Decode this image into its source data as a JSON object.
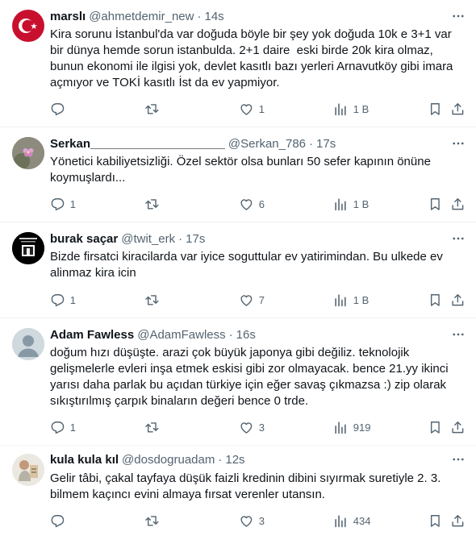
{
  "tweets": [
    {
      "name": "marslı",
      "handle": "@ahmetdemir_new",
      "time": "14s",
      "text": "Kira sorunu İstanbul'da var doğuda böyle bir şey yok doğuda 10k e 3+1 var\nbir dünya hemde sorun istanbulda. 2+1 daire  eski birde 20k kira olmaz,\nbunun ekonomi ile ilgisi yok, devlet kasıtlı bazı yerleri Arnavutköy gibi imara\naçmıyor ve TOKİ kasıtlı İst da ev yapmiyor.",
      "replies": "",
      "retweets": "",
      "likes": "1",
      "views": "1 B",
      "avatar": "flag-avatar"
    },
    {
      "name": "Serkan____________________",
      "handle": "@Serkan_786",
      "time": "17s",
      "text": "Yönetici kabiliyetsizliği. Özel sektör olsa bunları 50 sefer kapının önüne\nkoymuşlardı...",
      "replies": "1",
      "retweets": "",
      "likes": "6",
      "views": "1 B",
      "avatar": "flower-avatar"
    },
    {
      "name": "burak saçar",
      "handle": "@twit_erk",
      "time": "17s",
      "text": "Bizde firsatci kiracilarda var iyice soguttular ev yatirimindan. Bu ulkede ev\nalinmaz kira icin",
      "replies": "1",
      "retweets": "",
      "likes": "7",
      "views": "1 B",
      "avatar": "dark-avatar"
    },
    {
      "name": "Adam Fawless",
      "handle": "@AdamFawless",
      "time": "16s",
      "text": "doğum hızı düşüşte. arazi çok büyük japonya gibi değiliz. teknolojik\ngelişmelerle evleri inşa etmek eskisi gibi zor olmayacak. bence 21.yy ikinci\nyarısı daha parlak bu açıdan türkiye için eğer savaş çıkmazsa :) zip olarak\nsıkıştırılmış çarpık binaların değeri bence 0 trde.",
      "replies": "1",
      "retweets": "",
      "likes": "3",
      "views": "919",
      "avatar": "default-avatar"
    },
    {
      "name": "kula kula kıl",
      "handle": "@dosdogruadam",
      "time": "12s",
      "text": "Gelir tâbi, çakal tayfaya düşük faizli kredinin dibini sıyırmak suretiyle 2. 3.\nbilmem kaçıncı evini almaya fırsat verenler utansın.",
      "replies": "",
      "retweets": "",
      "likes": "3",
      "views": "434",
      "avatar": "photo-avatar"
    }
  ],
  "colors": {
    "text": "#0f1419",
    "secondary": "#536471",
    "divider": "#eff3f4"
  },
  "icons": {
    "reply": "reply-icon",
    "retweet": "retweet-icon",
    "like": "heart-icon",
    "views": "views-icon",
    "bookmark": "bookmark-icon",
    "share": "share-icon",
    "more": "more-icon"
  }
}
